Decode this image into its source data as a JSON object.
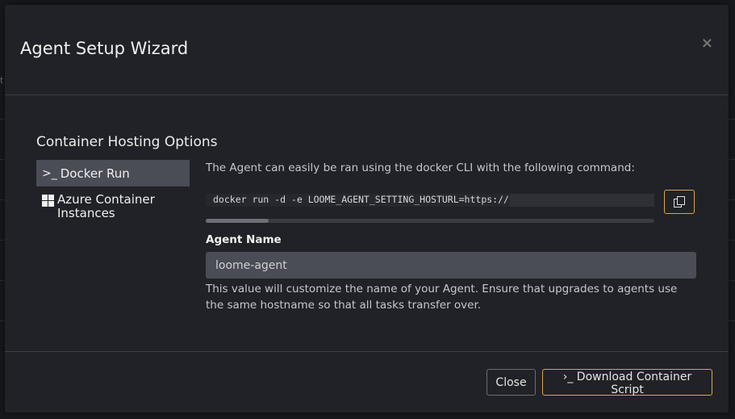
{
  "modal": {
    "title": "Agent Setup Wizard",
    "close_symbol": "×"
  },
  "section_title": "Container Hosting Options",
  "nav": {
    "items": [
      {
        "icon": "terminal-icon",
        "label": "Docker Run",
        "active": true
      },
      {
        "icon": "windows-icon",
        "label": "Azure Container Instances",
        "active": false
      }
    ]
  },
  "docker": {
    "description": "The Agent can easily be ran using the docker CLI with the following command:",
    "command": "docker run -d -e LOOME_AGENT_SETTING_HOSTURL=https://",
    "scroll_position": 0.14
  },
  "agent_name": {
    "label": "Agent Name",
    "value": "loome-agent",
    "help": "This value will customize the name of your Agent. Ensure that upgrades to agents use the same hostname so that all tasks transfer over."
  },
  "footer": {
    "close_label": "Close",
    "download_label": "Download Container Script",
    "download_prefix": "›_"
  },
  "colors": {
    "accent": "#d8a74a",
    "modal_bg": "#202227",
    "active_nav": "#4a4d56"
  }
}
